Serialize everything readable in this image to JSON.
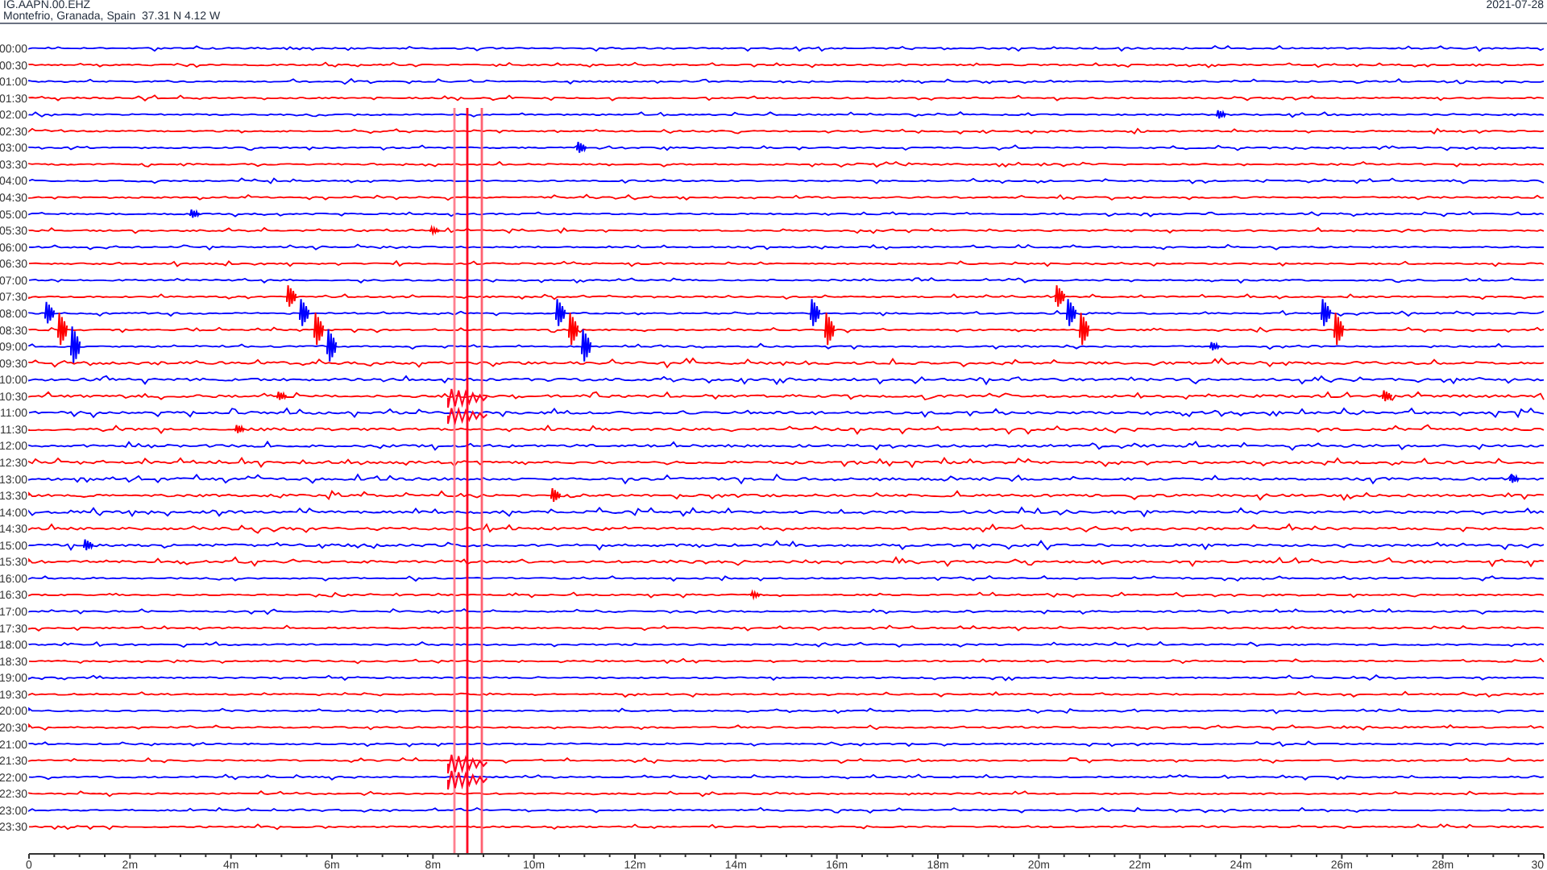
{
  "header": {
    "station": "IG.AAPN.00.EHZ",
    "location": "Montefrio, Granada, Spain  37.31 N 4.12 W",
    "date": "2021-07-28"
  },
  "rows": [
    {
      "label": "00:00",
      "color": "#0000ff"
    },
    {
      "label": "00:30",
      "color": "#ff0000"
    },
    {
      "label": "01:00",
      "color": "#0000ff"
    },
    {
      "label": "01:30",
      "color": "#ff0000"
    },
    {
      "label": "02:00",
      "color": "#0000ff"
    },
    {
      "label": "02:30",
      "color": "#ff0000"
    },
    {
      "label": "03:00",
      "color": "#0000ff"
    },
    {
      "label": "03:30",
      "color": "#ff0000"
    },
    {
      "label": "04:00",
      "color": "#0000ff"
    },
    {
      "label": "04:30",
      "color": "#ff0000"
    },
    {
      "label": "05:00",
      "color": "#0000ff"
    },
    {
      "label": "05:30",
      "color": "#ff0000"
    },
    {
      "label": "06:00",
      "color": "#0000ff"
    },
    {
      "label": "06:30",
      "color": "#ff0000"
    },
    {
      "label": "07:00",
      "color": "#0000ff"
    },
    {
      "label": "07:30",
      "color": "#ff0000"
    },
    {
      "label": "08:00",
      "color": "#0000ff"
    },
    {
      "label": "08:30",
      "color": "#ff0000"
    },
    {
      "label": "09:00",
      "color": "#0000ff"
    },
    {
      "label": "09:30",
      "color": "#ff0000"
    },
    {
      "label": "10:00",
      "color": "#0000ff"
    },
    {
      "label": "10:30",
      "color": "#ff0000"
    },
    {
      "label": "11:00",
      "color": "#0000ff"
    },
    {
      "label": "11:30",
      "color": "#ff0000"
    },
    {
      "label": "12:00",
      "color": "#0000ff"
    },
    {
      "label": "12:30",
      "color": "#ff0000"
    },
    {
      "label": "13:00",
      "color": "#0000ff"
    },
    {
      "label": "13:30",
      "color": "#ff0000"
    },
    {
      "label": "14:00",
      "color": "#0000ff"
    },
    {
      "label": "14:30",
      "color": "#ff0000"
    },
    {
      "label": "15:00",
      "color": "#0000ff"
    },
    {
      "label": "15:30",
      "color": "#ff0000"
    },
    {
      "label": "16:00",
      "color": "#0000ff"
    },
    {
      "label": "16:30",
      "color": "#ff0000"
    },
    {
      "label": "17:00",
      "color": "#0000ff"
    },
    {
      "label": "17:30",
      "color": "#ff0000"
    },
    {
      "label": "18:00",
      "color": "#0000ff"
    },
    {
      "label": "18:30",
      "color": "#ff0000"
    },
    {
      "label": "19:00",
      "color": "#0000ff"
    },
    {
      "label": "19:30",
      "color": "#ff0000"
    },
    {
      "label": "20:00",
      "color": "#0000ff"
    },
    {
      "label": "20:30",
      "color": "#ff0000"
    },
    {
      "label": "21:00",
      "color": "#0000ff"
    },
    {
      "label": "21:30",
      "color": "#ff0000"
    },
    {
      "label": "22:00",
      "color": "#0000ff"
    },
    {
      "label": "22:30",
      "color": "#ff0000"
    },
    {
      "label": "23:00",
      "color": "#0000ff"
    },
    {
      "label": "23:30",
      "color": "#ff0000"
    }
  ],
  "x_axis": {
    "ticks": [
      "0",
      "2m",
      "4m",
      "6m",
      "8m",
      "10m",
      "12m",
      "14m",
      "16m",
      "18m",
      "20m",
      "22m",
      "24m",
      "26m",
      "28m",
      "30"
    ]
  }
}
